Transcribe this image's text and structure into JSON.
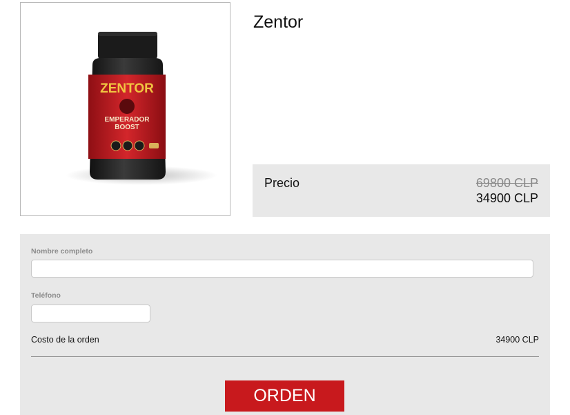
{
  "product": {
    "title": "Zentor",
    "image_alt": "Zentor product bottle",
    "label_brand": "ZENTOR",
    "label_line1": "EMPERADOR",
    "label_line2": "BOOST"
  },
  "price": {
    "label": "Precio",
    "old": "69800 CLP",
    "new": "34900 CLP"
  },
  "form": {
    "name_label": "Nombre completo",
    "name_value": "",
    "phone_label": "Teléfono",
    "phone_value": "",
    "cost_label": "Costo de la orden",
    "cost_value": "34900 CLP",
    "submit_label": "ORDEN"
  },
  "colors": {
    "panel_bg": "#e8e8e8",
    "button_bg": "#c8191d",
    "old_price": "#8a8a8a"
  }
}
